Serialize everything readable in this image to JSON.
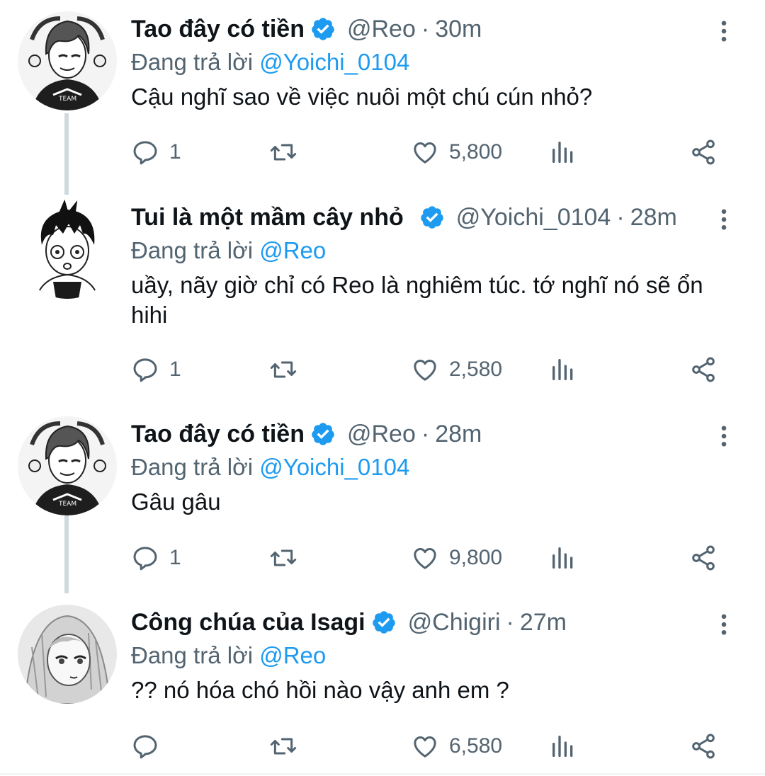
{
  "tweets": [
    {
      "name": "Tao đây có tiền",
      "handle": "@Reo",
      "time": "30m",
      "reply_prefix": "Đang trả lời",
      "reply_to": "@Yoichi_0104",
      "text": "Cậu nghĩ sao về việc nuôi một chú cún nhỏ?",
      "replies": "1",
      "likes": "5,800",
      "avatar": "reo-avatar"
    },
    {
      "name": "Tui là một mầm cây nhỏ",
      "handle": "@Yoichi_0104",
      "time": "28m",
      "reply_prefix": "Đang trả lời",
      "reply_to": "@Reo",
      "text": "uầy, nãy giờ chỉ có Reo là nghiêm túc. tớ nghĩ nó sẽ ổn hihi",
      "replies": "1",
      "likes": "2,580",
      "avatar": "isagi-avatar"
    },
    {
      "name": "Tao đây có tiền",
      "handle": "@Reo",
      "time": "28m",
      "reply_prefix": "Đang trả lời",
      "reply_to": "@Yoichi_0104",
      "text": "Gâu gâu",
      "replies": "1",
      "likes": "9,800",
      "avatar": "reo-avatar"
    },
    {
      "name": "Công chúa của Isagi",
      "handle": "@Chigiri",
      "time": "27m",
      "reply_prefix": "Đang trả lời",
      "reply_to": "@Reo",
      "text": "?? nó hóa chó hồi nào vậy anh em ?",
      "replies": "",
      "likes": "6,580",
      "avatar": "chigiri-avatar"
    }
  ],
  "colors": {
    "accent": "#1d9bf0",
    "secondary_text": "#536471",
    "thread_line": "#cfd9de"
  }
}
